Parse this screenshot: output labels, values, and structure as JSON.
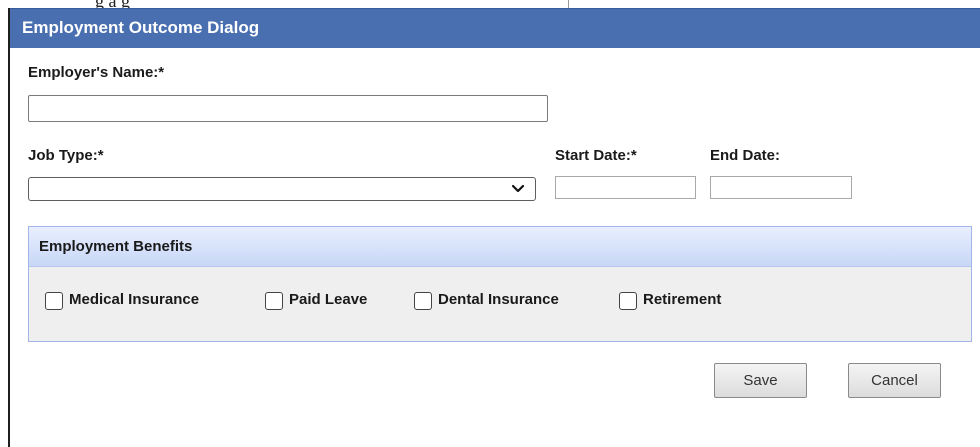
{
  "backdrop": {
    "partial_text": "g a g"
  },
  "dialog": {
    "title": "Employment Outcome Dialog"
  },
  "form": {
    "employer_name_label": "Employer's Name:*",
    "employer_name_value": "",
    "job_type_label": "Job Type:*",
    "job_type_value": "",
    "start_date_label": "Start Date:*",
    "start_date_value": "",
    "end_date_label": "End Date:",
    "end_date_value": ""
  },
  "benefits": {
    "title": "Employment Benefits",
    "options": [
      {
        "label": "Medical Insurance",
        "checked": false
      },
      {
        "label": "Paid Leave",
        "checked": false
      },
      {
        "label": "Dental Insurance",
        "checked": false
      },
      {
        "label": "Retirement",
        "checked": false
      }
    ]
  },
  "buttons": {
    "save_label": "Save",
    "cancel_label": "Cancel"
  },
  "icons": {
    "select_arrow": "chevron-down-icon"
  }
}
